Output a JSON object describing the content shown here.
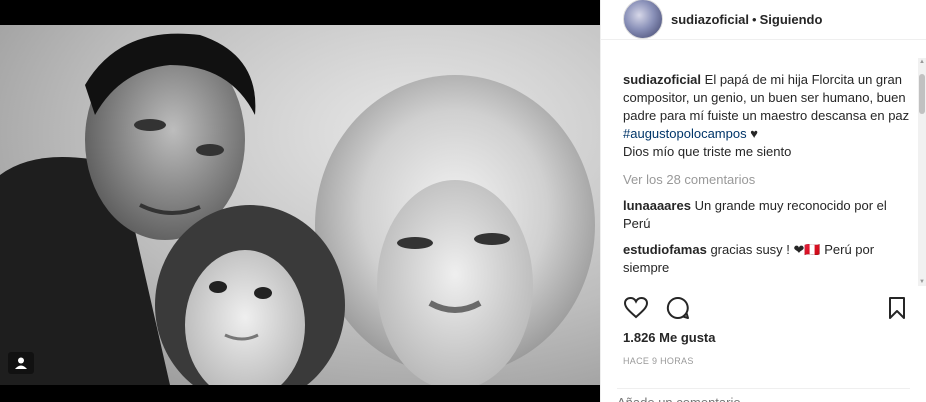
{
  "post": {
    "image_alt": "Black and white family photo: a man, a small girl and a blonde woman"
  },
  "header": {
    "username": "sudiazoficial",
    "separator": "•",
    "follow_status": "Siguiendo"
  },
  "caption": {
    "username": "sudiazoficial",
    "text": "El papá de mi hija Florcita un gran compositor, un genio, un buen ser humano, buen padre para mí fuiste un maestro descansa en paz",
    "hashtag": "#augustopolocampos",
    "emoji": "♥",
    "line2": "Dios mío que triste me siento"
  },
  "view_all_comments": "Ver los 28 comentarios",
  "comments": [
    {
      "username": "lunaaaares",
      "text": "Un grande muy reconocido por el Perú"
    },
    {
      "username": "estudiofamas",
      "text": "gracias susy ! ❤🇵🇪 Perú por siempre"
    }
  ],
  "actions": {
    "like_icon": "heart-outline-icon",
    "comment_icon": "speech-bubble-icon",
    "save_icon": "bookmark-icon"
  },
  "likes": "1.826 Me gusta",
  "timestamp": "HACE 9 HORAS",
  "add_comment_placeholder": "Añade un comentario...",
  "colors": {
    "hashtag": "#003569",
    "muted": "#999999",
    "text": "#262626"
  }
}
